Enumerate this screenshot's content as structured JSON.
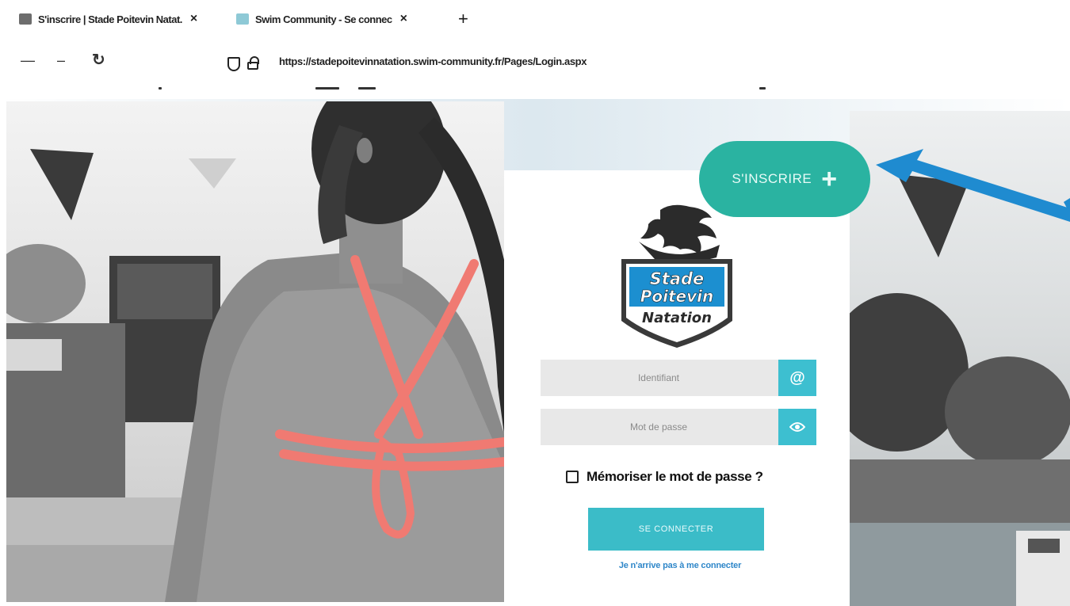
{
  "browser": {
    "tabs": [
      {
        "title": "S'inscrire | Stade Poitevin Natat.",
        "close": "×"
      },
      {
        "title": "Swim Community - Se connec",
        "close": "×"
      }
    ],
    "new_tab": "+",
    "url": "https://stadepoitevinnatation.swim-community.fr/Pages/Login.aspx",
    "icons": [
      "back-icon",
      "forward-icon",
      "reload-icon",
      "shield-icon",
      "lock-icon"
    ]
  },
  "page": {
    "signup": {
      "label": "S'INSCRIRE",
      "plus": "+"
    },
    "logo": {
      "line1": "Stade",
      "line2": "Poitevin",
      "line3": "Natation"
    },
    "email_field": {
      "placeholder": "Identifiant",
      "icon": "@"
    },
    "password_field": {
      "placeholder": "Mot de passe",
      "icon": "eye-icon"
    },
    "remember_label": "Mémoriser le mot de passe ?",
    "login_button": "SE CONNECTER",
    "help_link": "Je n'arrive pas à me connecter"
  },
  "colors": {
    "signup_green": "#2ab3a1",
    "field_accent": "#3dbfd0",
    "link_blue": "#2f87c9",
    "arrow_blue": "#1f8bd0",
    "logo_blue": "#1c8fd0",
    "swimsuit_coral": "#f07a72"
  }
}
